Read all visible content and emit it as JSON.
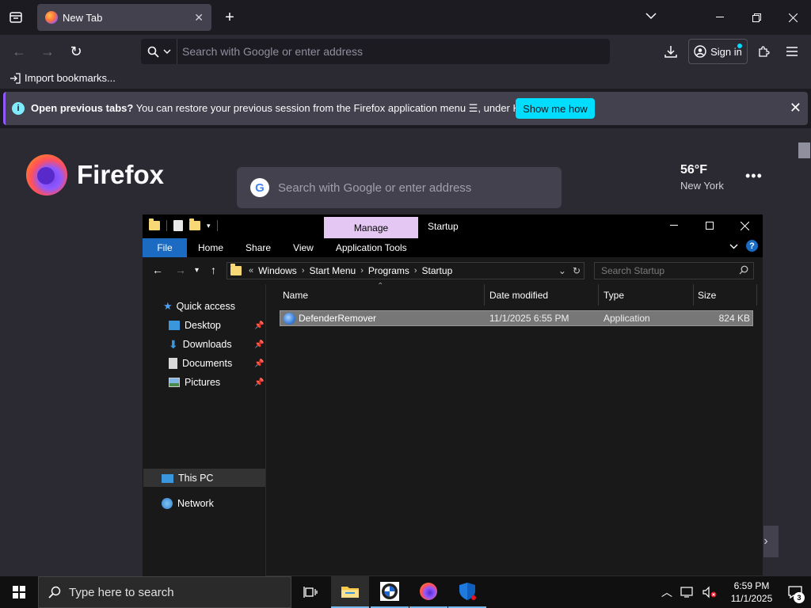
{
  "browser": {
    "tab": {
      "title": "New Tab",
      "close": "✕"
    },
    "new_tab_symbol": "+",
    "urlbar": {
      "placeholder": "Search with Google or enter address"
    },
    "signin_label": "Sign in",
    "bookmarks": {
      "import_label": "Import bookmarks..."
    },
    "infobar": {
      "bold": "Open previous tabs?",
      "text": " You can restore your previous session from the Firefox application menu ☰, under History.",
      "button": "Show me how"
    },
    "newtab": {
      "wordmark": "Firefox",
      "search_placeholder": "Search with Google or enter address",
      "weather_temp": "56°F",
      "weather_city": "New York"
    },
    "accent_color": "#00ddff"
  },
  "explorer": {
    "manage_tab": "Manage",
    "window_name": "Startup",
    "ribbon": {
      "file": "File",
      "tabs": [
        "Home",
        "Share",
        "View",
        "Application Tools"
      ]
    },
    "address": {
      "prefix": "«",
      "crumbs": [
        "Windows",
        "Start Menu",
        "Programs",
        "Startup"
      ]
    },
    "search_placeholder": "Search Startup",
    "nav": {
      "quick_access": "Quick access",
      "desktop": "Desktop",
      "downloads": "Downloads",
      "documents": "Documents",
      "pictures": "Pictures",
      "this_pc": "This PC",
      "network": "Network"
    },
    "columns": {
      "name": "Name",
      "date": "Date modified",
      "type": "Type",
      "size": "Size"
    },
    "files": [
      {
        "name": "DefenderRemover",
        "date": "11/1/2025 6:55 PM",
        "type": "Application",
        "size": "824 KB"
      }
    ]
  },
  "taskbar": {
    "search_placeholder": "Type here to search",
    "time": "6:59 PM",
    "date": "11/1/2025",
    "notification_count": "3"
  }
}
